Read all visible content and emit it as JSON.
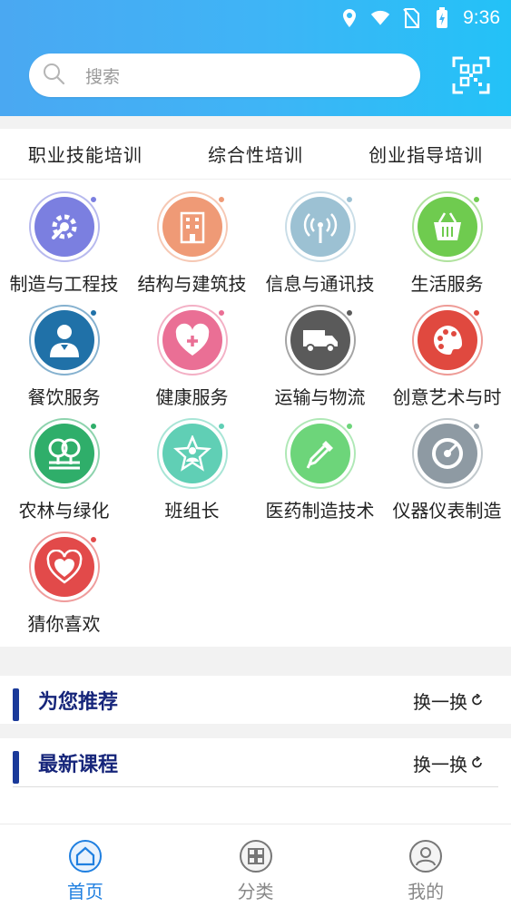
{
  "status_bar": {
    "time": "9:36"
  },
  "search": {
    "placeholder": "搜索"
  },
  "category_tabs": [
    "职业技能培训",
    "综合性培训",
    "创业指导培训"
  ],
  "categories": [
    {
      "label": "制造与工程技",
      "icon": "gear-wrench-icon",
      "color": "#7b7fe0"
    },
    {
      "label": "结构与建筑技",
      "icon": "building-icon",
      "color": "#ef9a76"
    },
    {
      "label": "信息与通讯技",
      "icon": "signal-tower-icon",
      "color": "#9cc1d3"
    },
    {
      "label": "生活服务",
      "icon": "basket-icon",
      "color": "#6fcb4f"
    },
    {
      "label": "餐饮服务",
      "icon": "waiter-icon",
      "color": "#2071a8"
    },
    {
      "label": "健康服务",
      "icon": "heart-plus-icon",
      "color": "#ea6f95"
    },
    {
      "label": "运输与物流",
      "icon": "truck-icon",
      "color": "#5a5a5a"
    },
    {
      "label": "创意艺术与时",
      "icon": "palette-icon",
      "color": "#e0493f"
    },
    {
      "label": "农林与绿化",
      "icon": "trees-icon",
      "color": "#2fae6a"
    },
    {
      "label": "班组长",
      "icon": "star-person-icon",
      "color": "#60cfb5"
    },
    {
      "label": "医药制造技术",
      "icon": "dropper-icon",
      "color": "#6dd57a"
    },
    {
      "label": "仪器仪表制造",
      "icon": "gauge-icon",
      "color": "#8e9aa3"
    },
    {
      "label": "猜你喜欢",
      "icon": "hearts-icon",
      "color": "#e24a4a"
    }
  ],
  "sections": [
    {
      "title": "为您推荐",
      "refresh_label": "换一换"
    },
    {
      "title": "最新课程",
      "refresh_label": "换一换"
    }
  ],
  "bottom_nav": [
    {
      "label": "首页",
      "icon": "home-icon",
      "active": true
    },
    {
      "label": "分类",
      "icon": "grid-icon",
      "active": false
    },
    {
      "label": "我的",
      "icon": "profile-icon",
      "active": false
    }
  ],
  "colors": {
    "header_start": "#4aa8f2",
    "header_end": "#23c2f7",
    "accent": "#1f7fe0",
    "section_bar": "#1a3a9a"
  }
}
